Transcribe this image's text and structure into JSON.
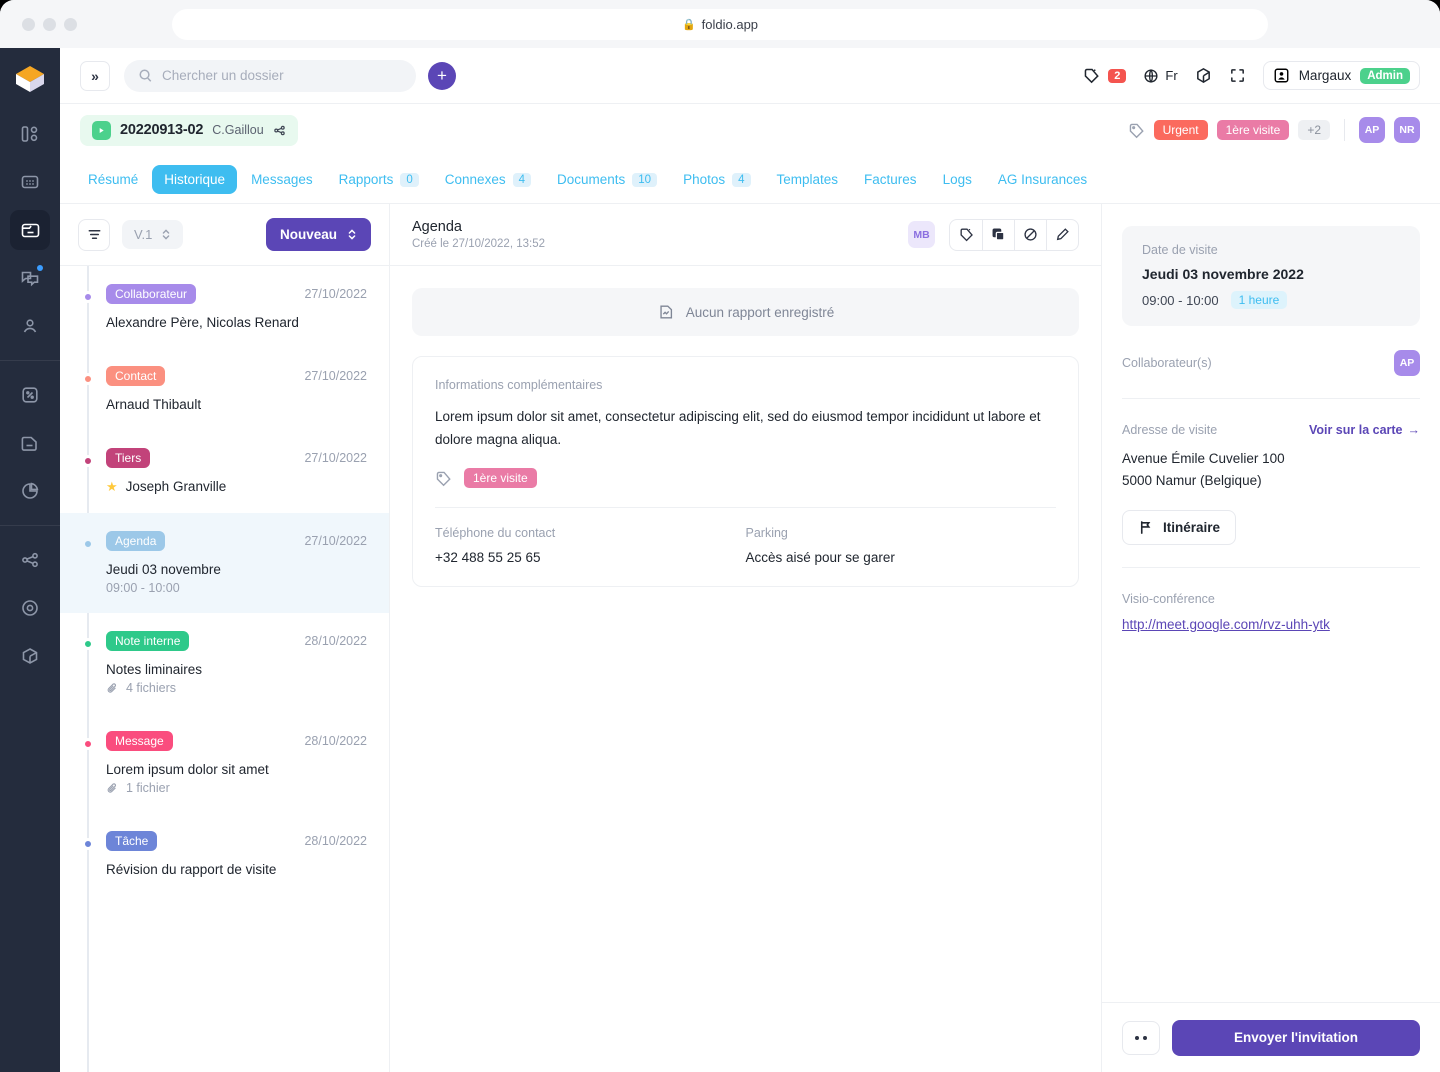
{
  "browser": {
    "url": "foldio.app",
    "lock_icon": "lock-icon"
  },
  "rail": {
    "logo": "foldio-logo",
    "items": [
      {
        "name": "dashboard",
        "icon": "dashboard-icon",
        "active": false,
        "dot": false
      },
      {
        "name": "grid",
        "icon": "grid-icon",
        "active": false,
        "dot": false
      },
      {
        "name": "folders",
        "icon": "folder-card-icon",
        "active": true,
        "dot": false
      },
      {
        "name": "messages",
        "icon": "chat-bubbles-icon",
        "active": false,
        "dot": true
      },
      {
        "name": "contacts",
        "icon": "user-icon",
        "active": false,
        "dot": false
      },
      {
        "name": "percent",
        "icon": "percent-box-icon",
        "active": false,
        "dot": false
      },
      {
        "name": "documents",
        "icon": "document-icon",
        "active": false,
        "dot": false
      },
      {
        "name": "stats",
        "icon": "pie-chart-icon",
        "active": false,
        "dot": false
      },
      {
        "name": "share",
        "icon": "share-network-icon",
        "active": false,
        "dot": false
      },
      {
        "name": "target",
        "icon": "target-icon",
        "active": false,
        "dot": false
      },
      {
        "name": "package",
        "icon": "package-icon",
        "active": false,
        "dot": false
      }
    ]
  },
  "topbar": {
    "collapse_label": "»",
    "search": {
      "placeholder": "Chercher un dossier",
      "value": ""
    },
    "add_label": "+",
    "notifications_count": "2",
    "language": "Fr",
    "user": {
      "name": "Margaux",
      "role": "Admin"
    }
  },
  "folder": {
    "reference": "20220913-02",
    "owner": "C.Gaillou",
    "tags": [
      {
        "label": "Urgent",
        "color": "#fb6a5e"
      },
      {
        "label": "1ère visite",
        "color": "#ea7ba6"
      }
    ],
    "tags_more": "+2",
    "avatars": [
      "AP",
      "NR"
    ]
  },
  "tabs": [
    {
      "label": "Résumé",
      "count": null,
      "active": false
    },
    {
      "label": "Historique",
      "count": null,
      "active": true
    },
    {
      "label": "Messages",
      "count": null,
      "active": false
    },
    {
      "label": "Rapports",
      "count": "0",
      "active": false
    },
    {
      "label": "Connexes",
      "count": "4",
      "active": false
    },
    {
      "label": "Documents",
      "count": "10",
      "active": false
    },
    {
      "label": "Photos",
      "count": "4",
      "active": false
    },
    {
      "label": "Templates",
      "count": null,
      "active": false
    },
    {
      "label": "Factures",
      "count": null,
      "active": false
    },
    {
      "label": "Logs",
      "count": null,
      "active": false
    },
    {
      "label": "AG Insurances",
      "count": null,
      "active": false
    }
  ],
  "timeline": {
    "version_label": "V.1",
    "new_label": "Nouveau",
    "items": [
      {
        "tag": "Collaborateur",
        "tag_color": "#a78bea",
        "date": "27/10/2022",
        "title": "Alexandre Père, Nicolas Renard",
        "sub": null,
        "sub_icon": null,
        "star": false,
        "active": false
      },
      {
        "tag": "Contact",
        "tag_color": "#fb9080",
        "date": "27/10/2022",
        "title": "Arnaud Thibault",
        "sub": null,
        "sub_icon": null,
        "star": false,
        "active": false
      },
      {
        "tag": "Tiers",
        "tag_color": "#c2437a",
        "date": "27/10/2022",
        "title": "Joseph Granville",
        "sub": null,
        "sub_icon": null,
        "star": true,
        "active": false
      },
      {
        "tag": "Agenda",
        "tag_color": "#9cc8e8",
        "date": "27/10/2022",
        "title": "Jeudi 03 novembre",
        "sub": "09:00 - 10:00",
        "sub_icon": null,
        "star": false,
        "active": true
      },
      {
        "tag": "Note interne",
        "tag_color": "#2ec98a",
        "date": "28/10/2022",
        "title": "Notes liminaires",
        "sub": "4 fichiers",
        "sub_icon": "paperclip-icon",
        "star": false,
        "active": false
      },
      {
        "tag": "Message",
        "tag_color": "#fa4d7e",
        "date": "28/10/2022",
        "title": "Lorem ipsum dolor sit amet",
        "sub": "1 fichier",
        "sub_icon": "paperclip-icon",
        "star": false,
        "active": false
      },
      {
        "tag": "Tâche",
        "tag_color": "#6d85d8",
        "date": "28/10/2022",
        "title": "Révision du rapport de visite",
        "sub": null,
        "sub_icon": null,
        "star": false,
        "active": false
      }
    ]
  },
  "center": {
    "title": "Agenda",
    "created": "Créé le 27/10/2022, 13:52",
    "avatar": "MB",
    "actions": [
      "tag-icon",
      "copy-icon",
      "ban-icon",
      "pencil-icon"
    ],
    "empty_report": "Aucun rapport enregistré",
    "card": {
      "label": "Informations complémentaires",
      "text": "Lorem ipsum dolor sit amet, consectetur adipiscing elit, sed do eiusmod tempor incididunt ut labore et dolore magna aliqua.",
      "tag": "1ère visite",
      "tag_color": "#ea7ba6",
      "fields": [
        {
          "key": "Téléphone du contact",
          "value": "+32 488 55 25 65"
        },
        {
          "key": "Parking",
          "value": "Accès aisé pour se garer"
        }
      ]
    }
  },
  "right": {
    "visit_date_label": "Date de visite",
    "visit_date": "Jeudi 03 novembre 2022",
    "visit_time": "09:00 - 10:00",
    "visit_duration": "1 heure",
    "collaborators_label": "Collaborateur(s)",
    "collaborators": [
      "AP"
    ],
    "address_label": "Adresse de visite",
    "map_link": "Voir sur la carte",
    "address_line1": "Avenue Émile Cuvelier 100",
    "address_line2": "5000 Namur (Belgique)",
    "itinerary_label": "Itinéraire",
    "visio_label": "Visio-conférence",
    "visio_url": "http://meet.google.com/rvz-uhh-ytk",
    "send_label": "Envoyer l'invitation"
  },
  "colors": {
    "brand_purple": "#5b46b6",
    "tab_blue": "#3ebdf0",
    "green": "#4cd18c",
    "red": "#f4544f",
    "rail_dark": "#242c3d"
  }
}
